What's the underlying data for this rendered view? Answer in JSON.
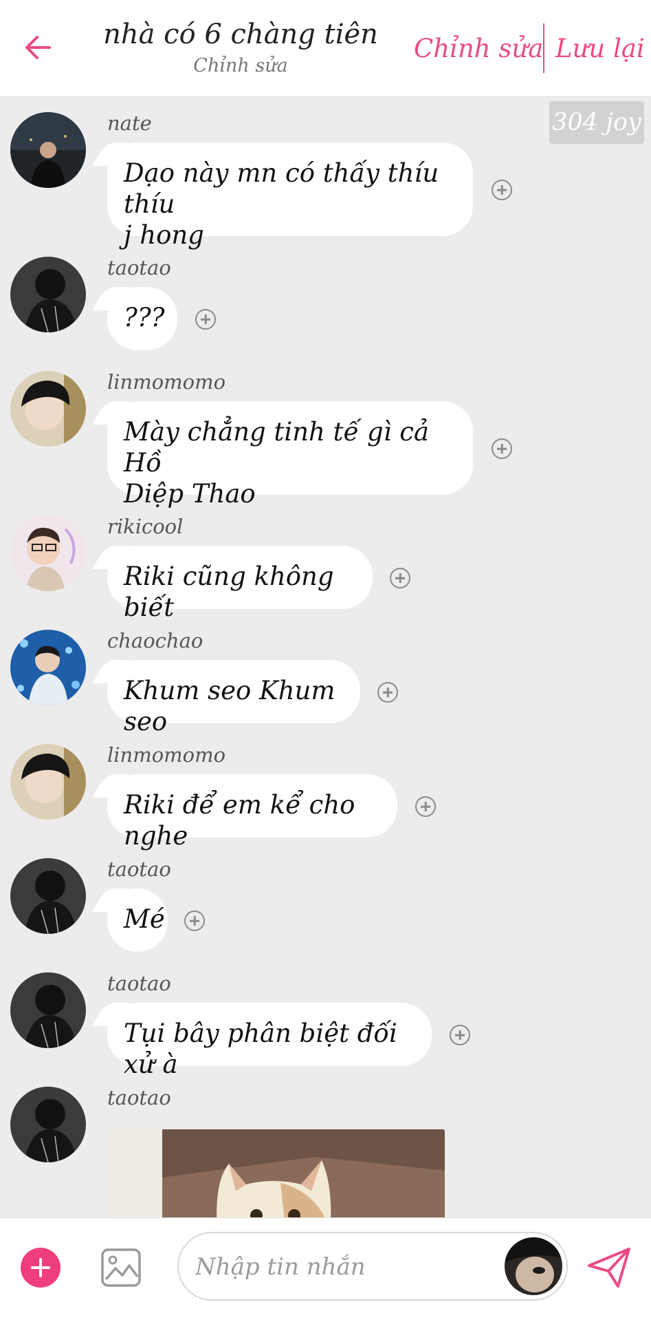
{
  "header": {
    "back_icon": "arrow-left-icon",
    "title": "nhà có 6 chàng tiên",
    "subtitle": "Chỉnh sửa",
    "edit_label": "Chỉnh sửa",
    "save_label": "Lưu lại",
    "accent_color": "#e94b87"
  },
  "badge": {
    "text": "304 joy"
  },
  "messages": [
    {
      "sender": "nate",
      "text": "Dạo này mn có thấy thíu thíu\nj hong"
    },
    {
      "sender": "taotao",
      "text": "???"
    },
    {
      "sender": "linmomomo",
      "text": "Mày chẳng tinh tế gì cả Hồ\nDiệp Thao"
    },
    {
      "sender": "rikicool",
      "text": "Riki cũng không biết"
    },
    {
      "sender": "chaochao",
      "text": "Khum seo Khum seo"
    },
    {
      "sender": "linmomomo",
      "text": "Riki để em kể cho nghe"
    },
    {
      "sender": "taotao",
      "text": "Mé"
    },
    {
      "sender": "taotao",
      "text": "Tụi bây phân biệt đối xử à"
    },
    {
      "sender": "taotao",
      "image": "cat-photo"
    }
  ],
  "input": {
    "placeholder": "Nhập tin nhắn",
    "add_icon": "plus-icon",
    "gallery_icon": "image-icon",
    "send_icon": "send-icon",
    "add_color": "#ef3d7d"
  }
}
